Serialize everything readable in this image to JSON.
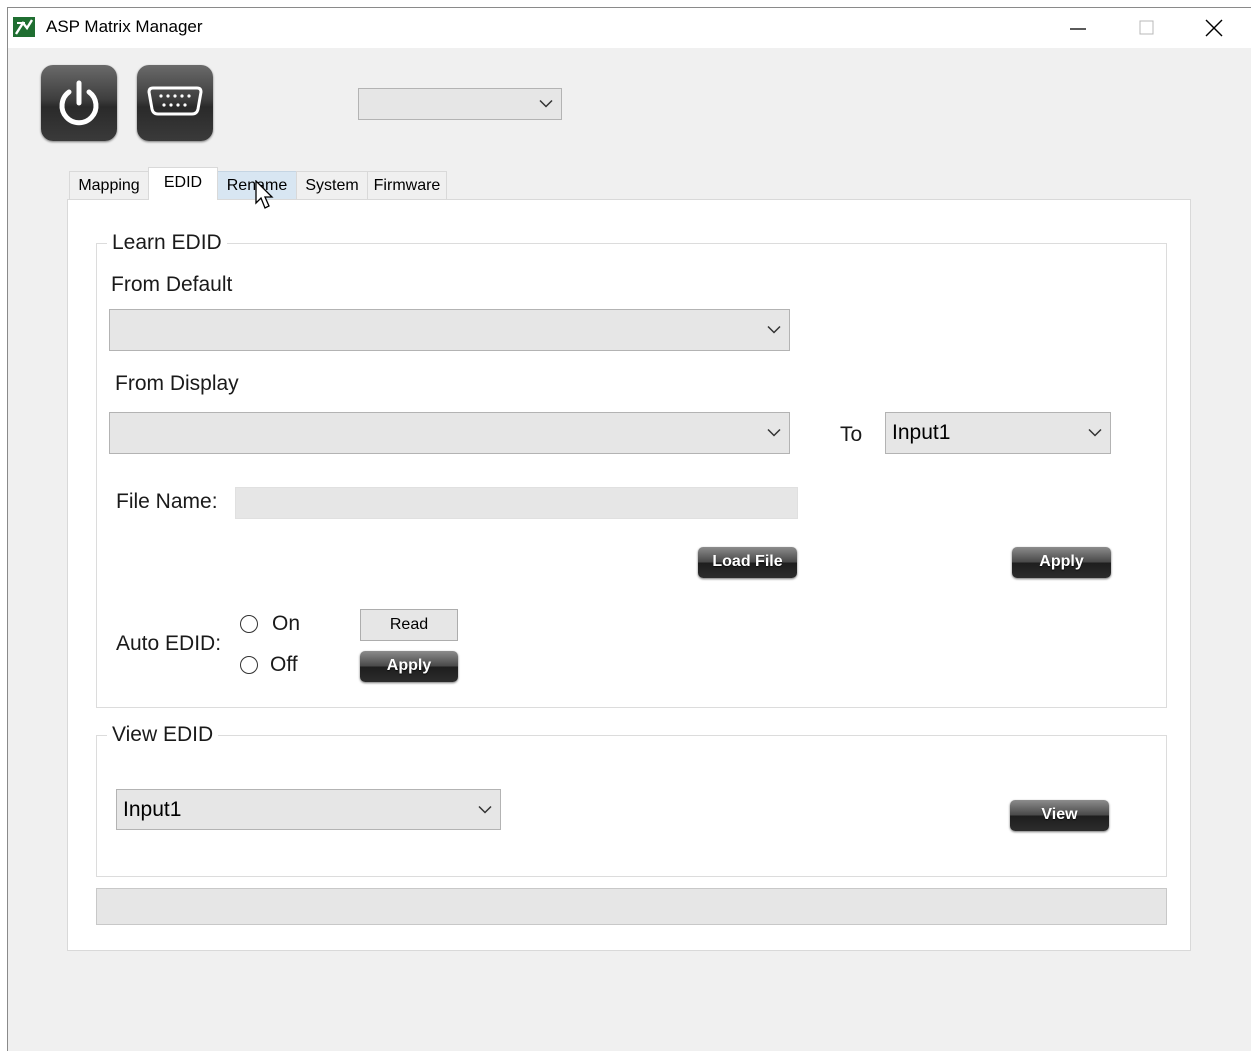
{
  "window": {
    "title": "ASP Matrix Manager"
  },
  "toolbar": {
    "power_icon": "power-icon",
    "serial_icon": "serial-port-icon",
    "port_select_value": ""
  },
  "tabs": [
    {
      "label": "Mapping",
      "active": false
    },
    {
      "label": "EDID",
      "active": true
    },
    {
      "label": "Rename",
      "active": false
    },
    {
      "label": "System",
      "active": false
    },
    {
      "label": "Firmware",
      "active": false
    }
  ],
  "learn_edid": {
    "legend": "Learn EDID",
    "from_default_label": "From Default",
    "from_default_value": "",
    "from_display_label": "From Display",
    "from_display_value": "",
    "to_label": "To",
    "to_value": "Input1",
    "file_name_label": "File Name:",
    "file_name_value": "",
    "load_file_label": "Load File",
    "apply_label": "Apply",
    "auto_edid_label": "Auto EDID:",
    "on_label": "On",
    "off_label": "Off",
    "read_label": "Read",
    "auto_apply_label": "Apply"
  },
  "view_edid": {
    "legend": "View EDID",
    "input_value": "Input1",
    "view_label": "View"
  },
  "status": {
    "text": ""
  }
}
